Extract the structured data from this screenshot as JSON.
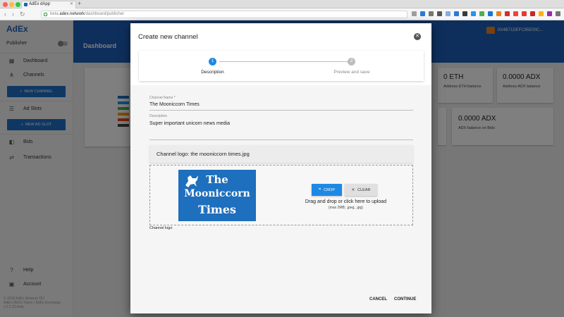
{
  "browser": {
    "tab_title": "AdEx dApp",
    "url_prefix": "beta.",
    "url_domain": "adex.network",
    "url_path": "/dashboard/publisher",
    "colors": {
      "close": "#fc5f57",
      "minimize": "#fdbc2e",
      "maximize": "#28c840"
    }
  },
  "sidebar": {
    "brand": "AdEx",
    "role": "Publisher",
    "items": [
      {
        "label": "Dashboard",
        "icon": "dashboard-icon"
      },
      {
        "label": "Channels",
        "icon": "channels-icon"
      },
      {
        "label": "Ad Slots",
        "icon": "list-icon"
      },
      {
        "label": "Bids",
        "icon": "bids-icon"
      },
      {
        "label": "Transactions",
        "icon": "transactions-icon"
      },
      {
        "label": "Help",
        "icon": "help-icon"
      },
      {
        "label": "Account",
        "icon": "account-icon"
      }
    ],
    "buttons": {
      "new_channel": "NEW CHANNEL",
      "new_ad_slot": "NEW AD SLOT"
    },
    "footer": {
      "line1": "© 2018 AdEx Network OÜ",
      "line2": "AdEx (ADX) Token / AdEx Exchange",
      "line3": "v.2.2.22-beta"
    }
  },
  "header": {
    "title": "Dashboard",
    "account": "0X4B71DEFC95E00C..."
  },
  "cards": [
    {
      "value": "0 ETH",
      "label": "Address ETH balance"
    },
    {
      "value": "0.0000 ADX",
      "label": "Address ADX balance"
    },
    {
      "value": "0.0000 ADX",
      "label": "ADX balance on Bids"
    }
  ],
  "modal": {
    "title": "Create new channel",
    "steps": [
      {
        "number": "1",
        "label": "Description"
      },
      {
        "number": "2",
        "label": "Preview and save"
      }
    ],
    "fields": {
      "name_label": "Channel Name *",
      "name_value": "The Mooniccorn Times",
      "description_label": "Description",
      "description_value": "Super important unicorn news media"
    },
    "logo_bar": "Channel logo: the mooniccorn times.jpg",
    "logo_image": {
      "line1": "The",
      "line2": "Mooniccorn",
      "line3": "Times"
    },
    "crop_label": "CROP",
    "clear_label": "CLEAR",
    "drop_text": "Drag and drop or click here to upload",
    "drop_sub": "(max 2MB; .jpeg, .jpg)",
    "logo_caption": "Channel logo",
    "cancel_label": "CANCEL",
    "continue_label": "CONTINUE",
    "accent": "#1e88e5"
  }
}
